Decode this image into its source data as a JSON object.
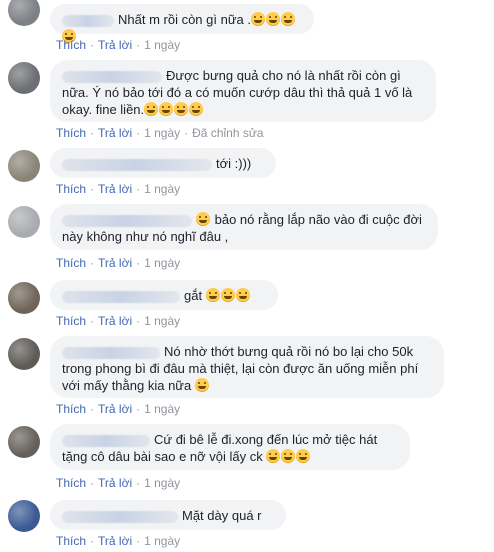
{
  "labels": {
    "like": "Thích",
    "reply": "Trả lời",
    "dot": "·"
  },
  "comments": [
    {
      "text": "Nhất m rồi còn gì nữa .",
      "emojis": 4,
      "time": "1 ngày",
      "edited": ""
    },
    {
      "text": "Được bưng quả cho nó là nhất rồi còn gì nữa. Ý nó bảo tới đó a có muốn cướp dâu thì thả quả 1 vố là okay. fine liền.",
      "emojis": 4,
      "time": "1 ngày",
      "edited": "Đã chỉnh sửa"
    },
    {
      "text": "tới :)))",
      "emojis": 0,
      "time": "1 ngày",
      "edited": ""
    },
    {
      "text": "bảo nó rằng lắp não vào đi cuộc đời này không như nó nghĩ đâu ,",
      "emojis": 1,
      "time": "1 ngày",
      "edited": ""
    },
    {
      "text": "gắt",
      "emojis": 3,
      "time": "1 ngày",
      "edited": ""
    },
    {
      "text": "Nó nhờ thớt bưng quả rồi nó bo lại cho 50k trong phong bì đi đâu mà thiệt, lại còn được ăn uống miễn phí với mấy thằng kia nữa",
      "emojis": 1,
      "time": "1 ngày",
      "edited": ""
    },
    {
      "text": "Cứ đi bê lễ đi.xong đến lúc mở tiệc hát tặng cô dâu bài sao e nỡ vội lấy ck",
      "emojis": 3,
      "time": "1 ngày",
      "edited": ""
    },
    {
      "text": "Mặt dày quá r",
      "emojis": 0,
      "time": "1 ngày",
      "edited": ""
    }
  ]
}
